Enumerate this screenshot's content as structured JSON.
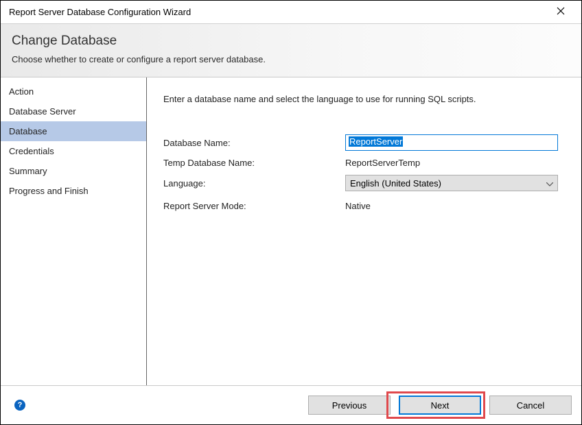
{
  "window": {
    "title": "Report Server Database Configuration Wizard"
  },
  "header": {
    "title": "Change Database",
    "subtitle": "Choose whether to create or configure a report server database."
  },
  "sidebar": {
    "items": [
      {
        "label": "Action"
      },
      {
        "label": "Database Server"
      },
      {
        "label": "Database"
      },
      {
        "label": "Credentials"
      },
      {
        "label": "Summary"
      },
      {
        "label": "Progress and Finish"
      }
    ]
  },
  "content": {
    "instruction": "Enter a database name and select the language to use for running SQL scripts.",
    "labels": {
      "db_name": "Database Name:",
      "temp_db_name": "Temp Database Name:",
      "language": "Language:",
      "mode": "Report Server Mode:"
    },
    "values": {
      "db_name": "ReportServer",
      "temp_db_name": "ReportServerTemp",
      "language": "English (United States)",
      "mode": "Native"
    }
  },
  "footer": {
    "previous": "Previous",
    "next": "Next",
    "cancel": "Cancel"
  }
}
